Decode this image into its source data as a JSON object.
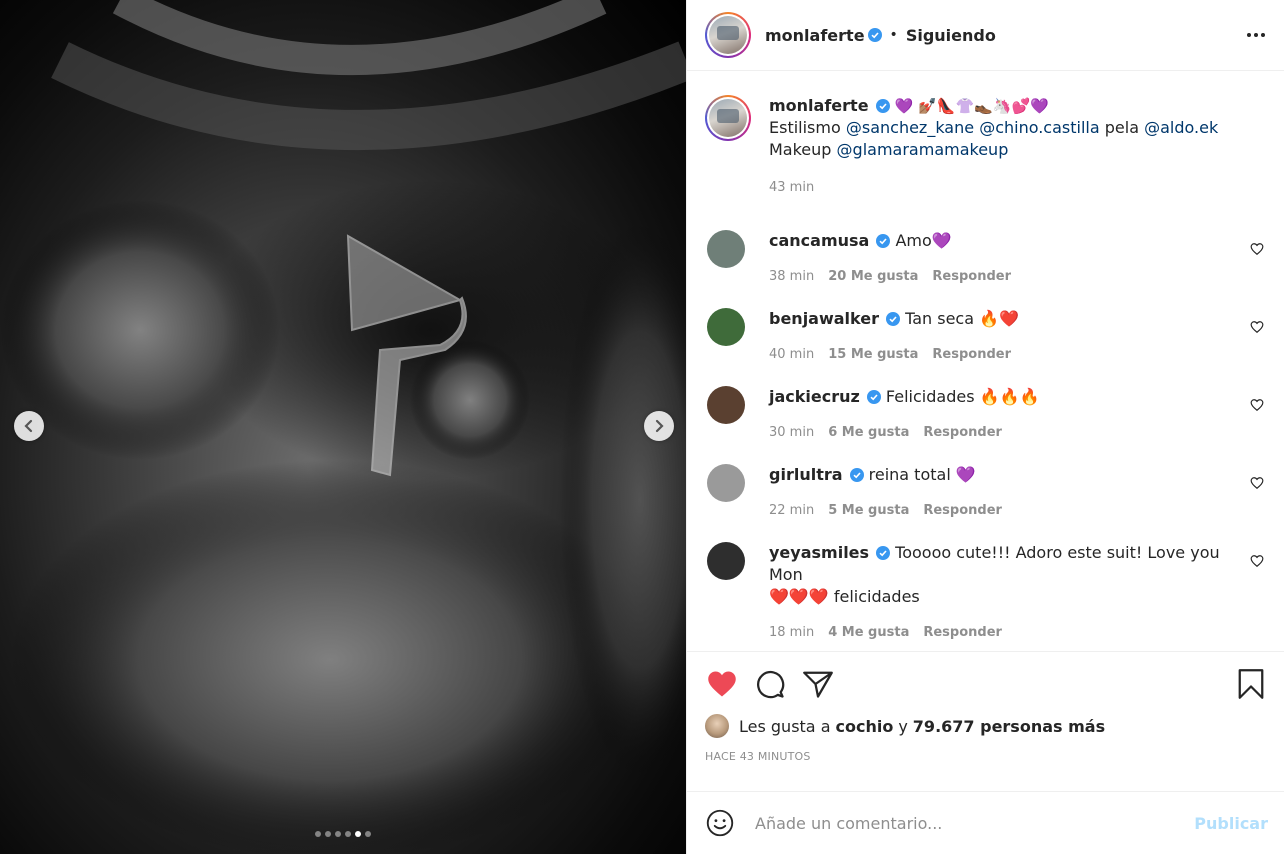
{
  "post": {
    "author": "monlaferte",
    "follow_label": "Siguiendo",
    "separator": "•",
    "more_icon": "more-horizontal-icon"
  },
  "carousel": {
    "total": 6,
    "active_index": 4,
    "prev_icon": "chevron-left-icon",
    "next_icon": "chevron-right-icon"
  },
  "caption": {
    "user": "monlaferte",
    "emojis": "💜 💅🏽👠👚👞🦄💕💜",
    "line1_prefix": "Estilismo",
    "mention1": "@sanchez_kane",
    "mention2": "@chino.castilla",
    "line1_mid": "pela",
    "mention3": "@aldo.ek",
    "line2_prefix": "Makeup",
    "mention4": "@glamaramamakeup",
    "time": "43 min"
  },
  "comments": [
    {
      "user": "cancamusa",
      "text": "Amo💜",
      "text2": "",
      "time": "38 min",
      "likes": "20 Me gusta",
      "reply": "Responder",
      "avatar_color": "#6f7f78"
    },
    {
      "user": "benjawalker",
      "text": "Tan seca 🔥❤️",
      "text2": "",
      "time": "40 min",
      "likes": "15 Me gusta",
      "reply": "Responder",
      "avatar_color": "#3f6b3a"
    },
    {
      "user": "jackiecruz",
      "text": "Felicidades 🔥🔥🔥",
      "text2": "",
      "time": "30 min",
      "likes": "6 Me gusta",
      "reply": "Responder",
      "avatar_color": "#5a4030"
    },
    {
      "user": "girlultra",
      "text": "reina total 💜",
      "text2": "",
      "time": "22 min",
      "likes": "5 Me gusta",
      "reply": "Responder",
      "avatar_color": "#9a9a9a"
    },
    {
      "user": "yeyasmiles",
      "text": "Tooooo cute!!! Adoro este suit! Love you Mon",
      "text2": "❤️❤️❤️ felicidades",
      "time": "18 min",
      "likes": "4 Me gusta",
      "reply": "Responder",
      "avatar_color": "#2e2e2e"
    }
  ],
  "actions": {
    "like_icon": "heart-filled-icon",
    "comment_icon": "comment-icon",
    "share_icon": "paper-plane-icon",
    "save_icon": "bookmark-icon",
    "like_color": "#ed4956"
  },
  "likes": {
    "prefix": "Les gusta a",
    "user": "cochio",
    "conj": "y",
    "count": "79.677 personas más"
  },
  "time_ago": "HACE 43 MINUTOS",
  "add_comment": {
    "placeholder": "Añade un comentario...",
    "publish_label": "Publicar",
    "emoji_icon": "smiley-icon",
    "publish_color": "#b2dffc"
  }
}
